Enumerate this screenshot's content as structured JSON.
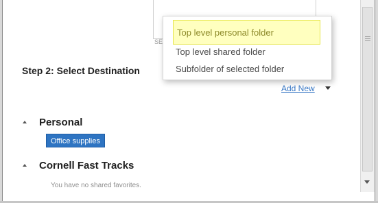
{
  "top_box": {
    "tail_text": "SE"
  },
  "step2": {
    "title": "Step 2: Select Destination"
  },
  "dropdown": {
    "items": [
      {
        "label": "Top level personal folder",
        "highlighted": true
      },
      {
        "label": "Top level shared folder",
        "highlighted": false
      },
      {
        "label": "Subfolder of selected folder",
        "highlighted": false
      }
    ]
  },
  "add_new": {
    "label": "Add New"
  },
  "personal": {
    "title": "Personal",
    "folder_tag": "Office supplies"
  },
  "shared": {
    "title": "Cornell Fast Tracks",
    "empty_message": "You have no shared favorites."
  },
  "colors": {
    "accent": "#2e74c2",
    "highlight_bg": "#ffffbf",
    "highlight_border": "#e6e64a",
    "link": "#3a79c6"
  }
}
